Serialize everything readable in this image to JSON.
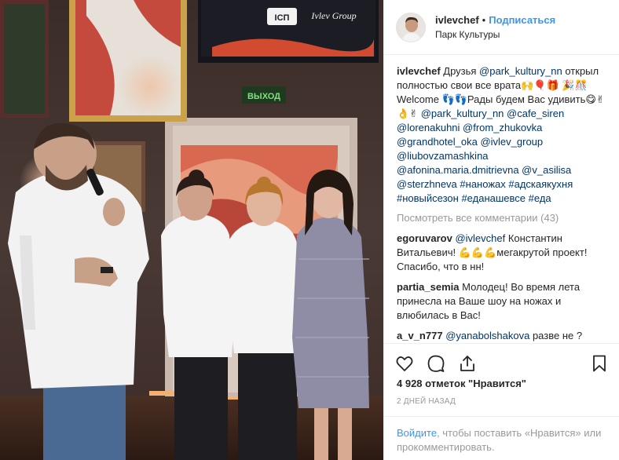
{
  "post": {
    "username": "ivlevchef",
    "separator": "•",
    "follow_label": "Подписаться",
    "location": "Парк Культуры"
  },
  "caption": {
    "username": "ivlevchef",
    "text_1": " Друзья ",
    "mention_1": "@park_kultury_nn",
    "text_2": " открыл полностью свои все врата🙌🎈🎁 🎉🎊Welcome 👣👣Рады будем Вас удивить😋✌👌✌ ",
    "mention_2": "@park_kultury_nn",
    "mention_3": "@cafe_siren",
    "mention_4": "@lorenakuhni",
    "mention_5": "@from_zhukovka",
    "mention_6": "@grandhotel_oka",
    "mention_7": "@ivlev_group",
    "mention_8": "@liubovzamashkina",
    "mention_9": "@afonina.maria.dmitrievna",
    "mention_10": "@v_asilisa",
    "mention_11": "@sterzhneva",
    "tag_1": "#наножах",
    "tag_2": "#адскаякухня",
    "tag_3": "#новыйсезон",
    "tag_4": "#еданашевсе",
    "tag_5": "#еда"
  },
  "view_all": "Посмотреть все комментарии (43)",
  "comments": [
    {
      "username": "egoruvarov",
      "mention": "@ivlevchef",
      "text": " Константин Витальевич! 💪💪💪мегакрутой проект! Спасибо, что в нн!"
    },
    {
      "username": "partia_semia",
      "mention": "",
      "text": " Молодец! Во время лета принесла на Ваше шоу на ножах и влюбилась в Вас!"
    },
    {
      "username": "a_v_n777",
      "mention": "@yanabolshakova",
      "text": " разве не ?"
    }
  ],
  "likes": "4 928 отметок \"Нравится\"",
  "time": "2 ДНЕЙ НАЗАД",
  "login": {
    "link": "Войдите",
    "text": ", чтобы поставить «Нравится» или прокомментировать."
  },
  "photo": {
    "sign_exit": "ВЫХОД",
    "screen_logo": "ICП",
    "screen_text": "Ivlev Group"
  },
  "icons": {
    "like": "heart-icon",
    "comment": "comment-icon",
    "share": "share-icon",
    "save": "bookmark-icon"
  }
}
